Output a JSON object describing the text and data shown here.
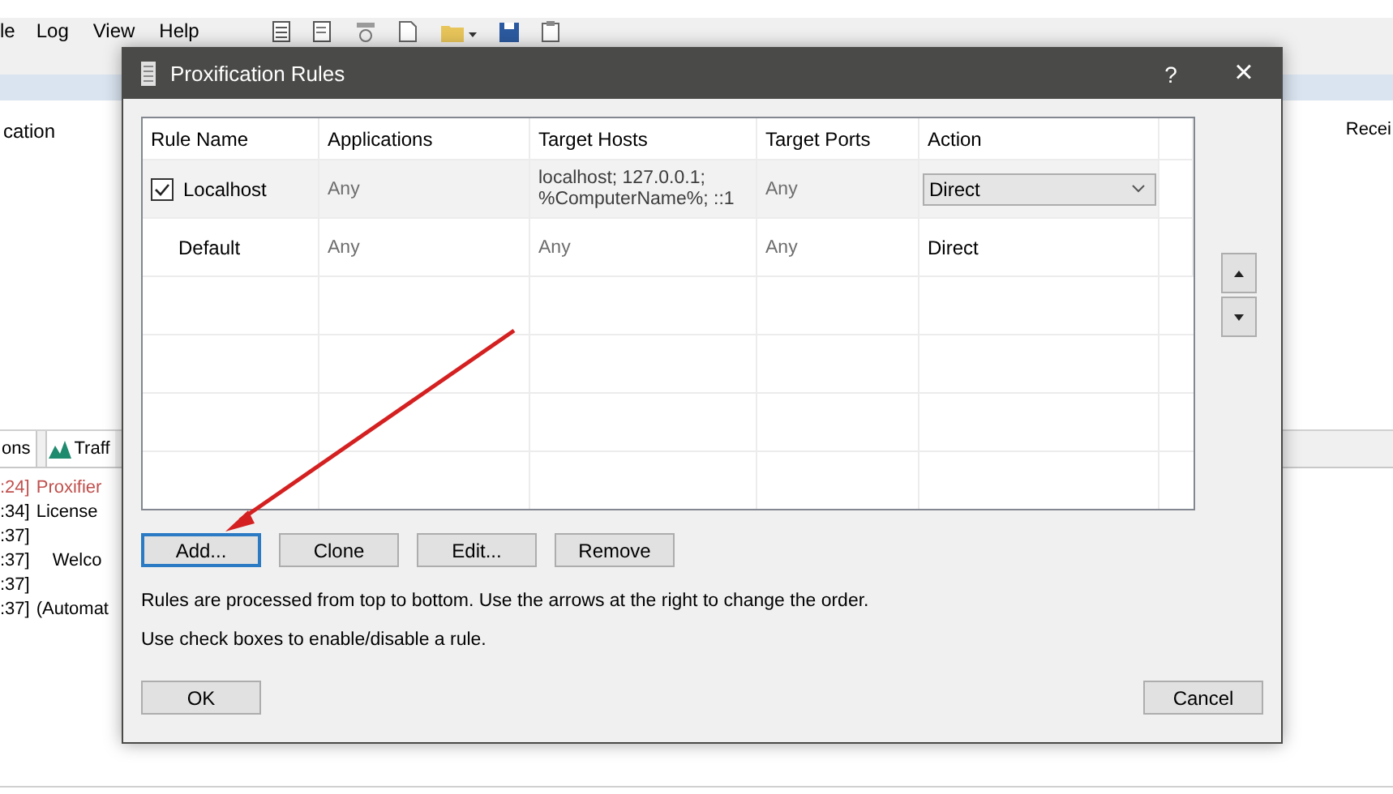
{
  "app": {
    "menu": [
      "le",
      "Log",
      "View",
      "Help"
    ],
    "columns": [
      "cation",
      "Recei"
    ],
    "tabs": [
      "ons",
      "Traff"
    ],
    "log": [
      {
        "time": ":24]",
        "message": "Proxifier",
        "kind": "error"
      },
      {
        "time": ":34]",
        "message": "License",
        "kind": "info"
      },
      {
        "time": ":37]",
        "kind": "info"
      },
      {
        "time": ":37]",
        "message": "Welco",
        "kind": "indent"
      },
      {
        "time": ":37]",
        "kind": "info"
      },
      {
        "time": ":37]",
        "message": "(Automat",
        "kind": "info"
      }
    ]
  },
  "dialog": {
    "title": "Proxification Rules",
    "help": "?",
    "close": "×",
    "table": {
      "columns": [
        "Rule Name",
        "Applications",
        "Target Hosts",
        "Target Ports",
        "Action"
      ],
      "rows": [
        {
          "kind": "rule",
          "checked": true,
          "selected": true,
          "name": "Localhost",
          "applications": "Any",
          "hosts": "localhost; 127.0.0.1; %ComputerName%; ::1",
          "ports": "Any",
          "action": "Direct"
        },
        {
          "kind": "default",
          "selected": false,
          "name": "Default",
          "applications": "Any",
          "hosts": "Any",
          "ports": "Any",
          "action": "Direct"
        }
      ]
    },
    "buttons": [
      {
        "label": "Add...",
        "focused": true
      },
      {
        "label": "Clone",
        "focused": false
      },
      {
        "label": "Edit...",
        "focused": false
      },
      {
        "label": "Remove",
        "focused": false
      }
    ],
    "notes": [
      "Rules are processed from top to bottom. Use the arrows at the right to change the order.",
      "Use check boxes to enable/disable a rule."
    ],
    "ok": "OK",
    "cancel": "Cancel"
  }
}
